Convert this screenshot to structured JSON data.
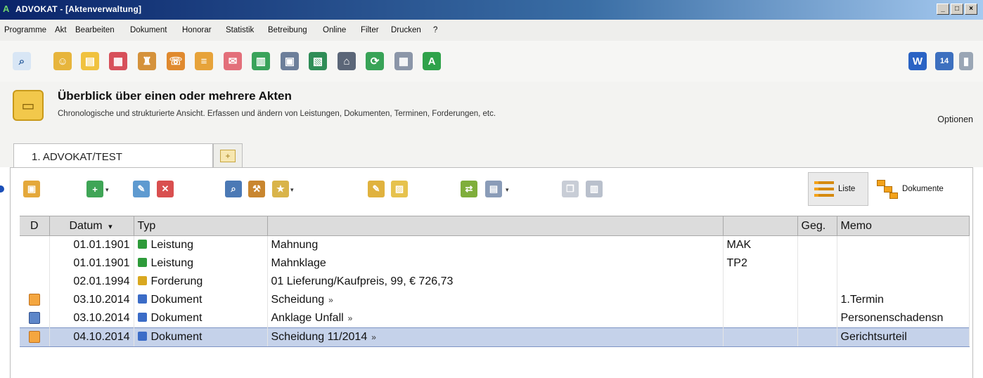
{
  "window": {
    "title": "ADVOKAT - [Aktenverwaltung]",
    "buttons": [
      "_",
      "□",
      "×"
    ]
  },
  "menu": [
    "Programme",
    "Akt",
    "Bearbeiten",
    "Dokument",
    "Honorar",
    "Statistik",
    "Betreibung",
    "Online",
    "Filter",
    "Drucken",
    "?"
  ],
  "toolbar": {
    "icons": [
      "search-icon",
      "contacts-icon",
      "files-icon",
      "calendar-icon",
      "user-tools-icon",
      "phone-icon",
      "notes-icon",
      "mail-icon",
      "bookshelf-icon",
      "printer-icon",
      "statistics-icon",
      "bank-icon",
      "sync-icon",
      "calculator-icon",
      "advokat-logo-icon"
    ],
    "right_icons": [
      "word-icon",
      "calendar-14-icon",
      "archive-icon"
    ]
  },
  "header": {
    "title": "Überblick über einen oder mehrere Akten",
    "subtitle": "Chronologische und strukturierte Ansicht. Erfassen und ändern von Leistungen, Dokumenten, Terminen, Forderungen, etc.",
    "options_label": "Optionen"
  },
  "tabs": {
    "active_label": "1. ADVOKAT/TEST"
  },
  "views": {
    "list_label": "Liste",
    "docs_label": "Dokumente"
  },
  "table": {
    "columns": [
      "D",
      "Datum",
      "Typ",
      "",
      "",
      "Geg.",
      "Memo"
    ],
    "rows": [
      {
        "doc_icon": "",
        "date": "01.01.1901",
        "type": "Leistung",
        "type_color": "#2e9b3a",
        "desc": "Mahnung",
        "arrow": "",
        "code": "MAK",
        "geg": "",
        "memo": ""
      },
      {
        "doc_icon": "",
        "date": "01.01.1901",
        "type": "Leistung",
        "type_color": "#2e9b3a",
        "desc": "Mahnklage",
        "arrow": "",
        "code": "TP2",
        "geg": "",
        "memo": ""
      },
      {
        "doc_icon": "",
        "date": "02.01.1994",
        "type": "Forderung",
        "type_color": "#d9a820",
        "desc": "01 Lieferung/Kaufpreis, 99, € 726,73",
        "arrow": "",
        "code": "",
        "geg": "",
        "memo": ""
      },
      {
        "doc_icon": "pdf-icon",
        "date": "03.10.2014",
        "type": "Dokument",
        "type_color": "#3b6cc7",
        "desc": "Scheidung",
        "arrow": "»",
        "code": "",
        "geg": "",
        "memo": "1.Termin"
      },
      {
        "doc_icon": "word-doc-icon",
        "date": "03.10.2014",
        "type": "Dokument",
        "type_color": "#3b6cc7",
        "desc": "Anklage Unfall",
        "arrow": "»",
        "code": "",
        "geg": "",
        "memo": "Personenschadensn"
      },
      {
        "doc_icon": "pdf-icon",
        "date": "04.10.2014",
        "type": "Dokument",
        "type_color": "#3b6cc7",
        "desc": "Scheidung 11/2014",
        "arrow": "»",
        "code": "",
        "geg": "",
        "memo": "Gerichtsurteil",
        "selected": true
      }
    ]
  },
  "colors": {
    "titlebar": "#0a246a",
    "selection": "#c5d2ea",
    "header_bg": "#dcdcdc"
  }
}
